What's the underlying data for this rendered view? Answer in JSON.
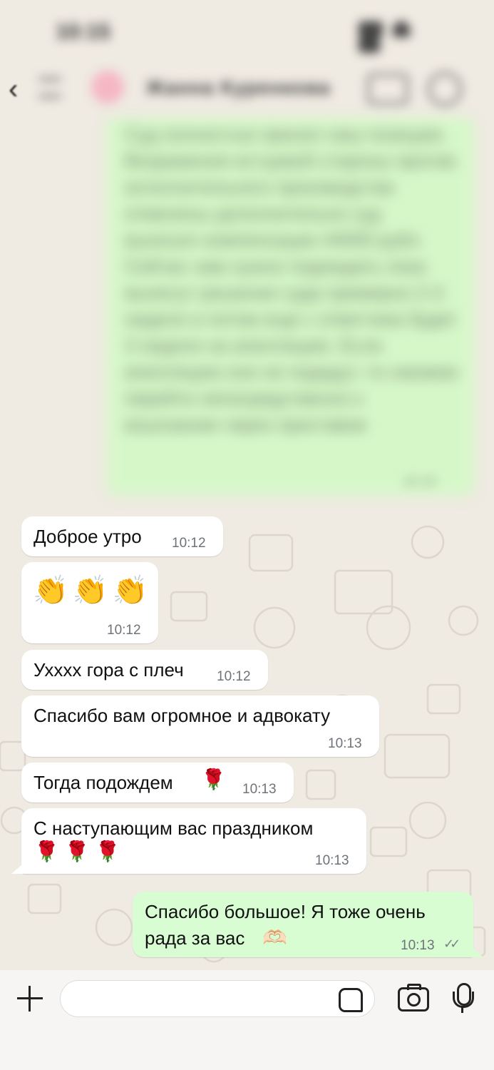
{
  "status_bar": {
    "time": "10:15"
  },
  "header": {
    "back_glyph": "‹",
    "contact_name": "Жанна Куренкова",
    "icons": [
      "menu-icon",
      "video-call-icon",
      "phone-icon"
    ]
  },
  "blurred_message": {
    "text": "Суд полностью принял наш позицию. Возражения истцовой стороны против исполнительного производства отменены дополнительно суд выносил компенсации 44000 рубл. Сейчас нам нужно подождать пока вынесут решение суда примерно 2-3 недели а потом еще с ответчика будет 3 недели на апелляцию. Если апелляцию они не подадут, то сможем перейти непосредственно к взысканию через приставов",
    "time": "10:10"
  },
  "messages": [
    {
      "direction": "in",
      "text": "Доброе утро",
      "time": "10:12"
    },
    {
      "direction": "in",
      "emoji": [
        "👏",
        "👏",
        "👏"
      ],
      "time": "10:12"
    },
    {
      "direction": "in",
      "text": "Ухххх гора с плеч",
      "time": "10:12"
    },
    {
      "direction": "in",
      "text": "Спасибо вам огромное и адвокату",
      "time": "10:13"
    },
    {
      "direction": "in",
      "text": "Тогда подождем",
      "emoji": "🌹",
      "time": "10:13"
    },
    {
      "direction": "in",
      "text": "С наступающим вас праздником",
      "emoji": [
        "🌹",
        "🌹",
        "🌹"
      ],
      "time": "10:13"
    },
    {
      "direction": "out",
      "line1": "Спасибо большое! Я тоже очень",
      "line2": "рада за вас",
      "emoji": "🫶🏻",
      "time": "10:13",
      "status": "read-ticks-icon"
    }
  ],
  "composer": {
    "placeholder": "",
    "icons": [
      "plus-icon",
      "sticker-icon",
      "camera-icon",
      "mic-icon"
    ]
  },
  "colors": {
    "background": "#efeae2",
    "incoming_bubble": "#ffffff",
    "outgoing_bubble": "#d9fdd3",
    "timestamp": "#6d7378"
  }
}
